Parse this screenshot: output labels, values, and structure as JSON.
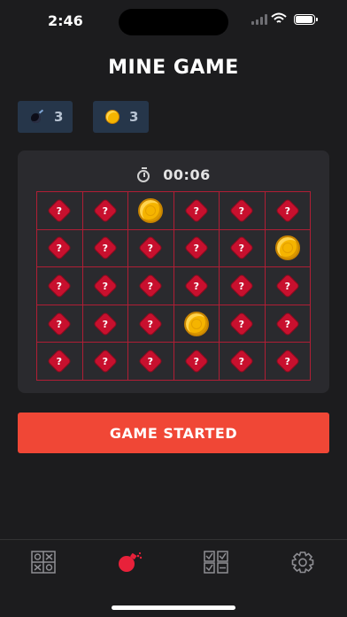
{
  "status_bar": {
    "time": "2:46"
  },
  "title": "MINE GAME",
  "counters": {
    "bombs": "3",
    "coins": "3"
  },
  "timer": {
    "text": "00:06"
  },
  "board": {
    "rows": 5,
    "cols": 6,
    "hidden_glyph": "?",
    "cells": [
      [
        "hidden",
        "hidden",
        "coin",
        "hidden",
        "hidden",
        "hidden"
      ],
      [
        "hidden",
        "hidden",
        "hidden",
        "hidden",
        "hidden",
        "coin"
      ],
      [
        "hidden",
        "hidden",
        "hidden",
        "hidden",
        "hidden",
        "hidden"
      ],
      [
        "hidden",
        "hidden",
        "hidden",
        "coin",
        "hidden",
        "hidden"
      ],
      [
        "hidden",
        "hidden",
        "hidden",
        "hidden",
        "hidden",
        "hidden"
      ]
    ]
  },
  "action_button": {
    "label": "GAME STARTED"
  },
  "tabs": [
    {
      "icon": "tic-tac-toe-grid-icon"
    },
    {
      "icon": "bomb-icon",
      "active": true
    },
    {
      "icon": "checklist-grid-icon"
    },
    {
      "icon": "gear-icon"
    }
  ],
  "colors": {
    "accent": "#f04736",
    "board_line": "#b01e35",
    "diamond": "#c8102e",
    "coin": "#f5b400",
    "counter_bg": "#26364a"
  }
}
